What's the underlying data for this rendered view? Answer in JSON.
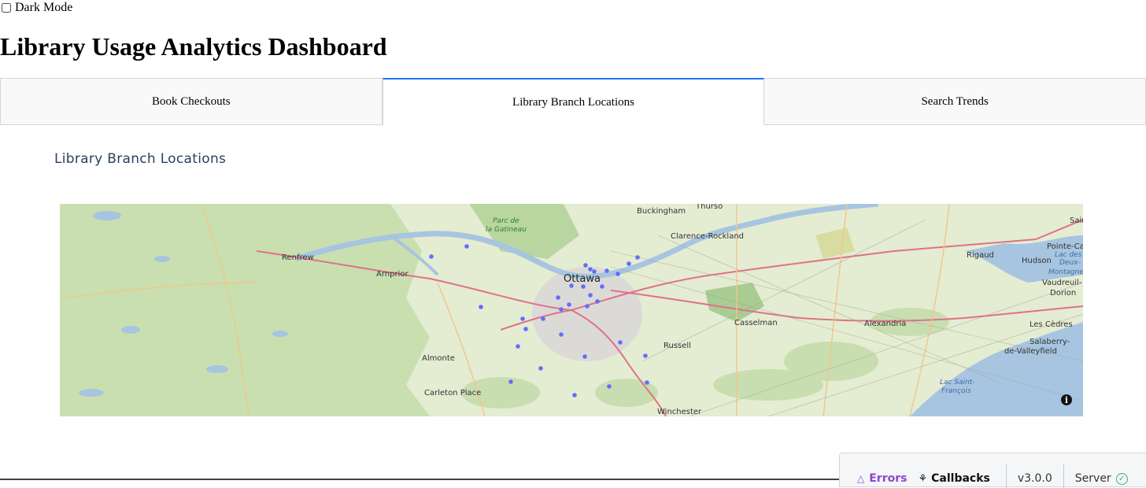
{
  "dark_mode": {
    "label": "Dark Mode",
    "checked": false
  },
  "title": "Library Usage Analytics Dashboard",
  "tabs": [
    {
      "label": "Book Checkouts",
      "selected": false
    },
    {
      "label": "Library Branch Locations",
      "selected": true
    },
    {
      "label": "Search Trends",
      "selected": false
    }
  ],
  "section_heading": "Library Branch Locations",
  "map": {
    "marker_color": "#636efa",
    "place_labels": [
      "Buckingham",
      "Thurso",
      "Clarence-Rockland",
      "Parc de",
      "la Gatineau",
      "Renfrew",
      "Arnprior",
      "Ottawa",
      "Rigaud",
      "Hudson",
      "Pointe-Ca",
      "Lac des",
      "Deux-",
      "Montagne",
      "Vaudreuil-",
      "Dorion",
      "Sain",
      "Casselman",
      "Alexandria",
      "Les Cèdres",
      "Russell",
      "Almonte",
      "Salaberry-",
      "de-Valleyfield",
      "Lac Saint-",
      "François",
      "Carleton Place",
      "Winchester"
    ],
    "info_icon": "info-icon"
  },
  "devtools": {
    "errors_label": "Errors",
    "errors_icon": "warning-triangle-icon",
    "callbacks_label": "Callbacks",
    "callbacks_icon": "callbacks-graph-icon",
    "version": "v3.0.0",
    "server_label": "Server",
    "server_icon": "check-circle-icon",
    "server_color": "#3cb371"
  }
}
